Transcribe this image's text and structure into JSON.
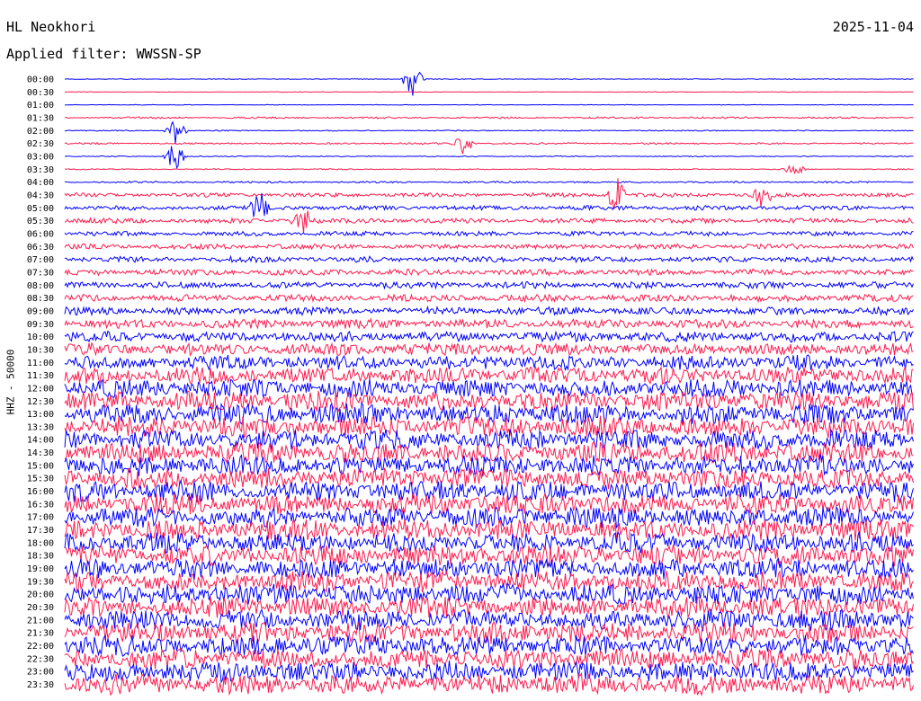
{
  "header": {
    "station": "HL Neokhori",
    "date": "2025-11-04",
    "filter_text": "Applied filter: WWSSN-SP"
  },
  "chart_data": {
    "type": "line",
    "channel_label": "HHZ - 50000",
    "colors": [
      "#0000ff",
      "#ff1a4d"
    ],
    "time_labels": [
      "00:00",
      "00:30",
      "01:00",
      "01:30",
      "02:00",
      "02:30",
      "03:00",
      "03:30",
      "04:00",
      "04:30",
      "05:00",
      "05:30",
      "06:00",
      "06:30",
      "07:00",
      "07:30",
      "08:00",
      "08:30",
      "09:00",
      "09:30",
      "10:00",
      "10:30",
      "11:00",
      "11:30",
      "12:00",
      "12:30",
      "13:00",
      "13:30",
      "14:00",
      "14:30",
      "15:00",
      "15:30",
      "16:00",
      "16:30",
      "17:00",
      "17:30",
      "18:00",
      "18:30",
      "19:00",
      "19:30",
      "20:00",
      "20:30",
      "21:00",
      "21:30",
      "22:00",
      "22:30",
      "23:00",
      "23:30"
    ],
    "relative_amplitude": [
      0.15,
      0.12,
      0.12,
      0.35,
      0.2,
      0.35,
      0.2,
      0.2,
      0.35,
      0.8,
      0.9,
      1.0,
      0.9,
      1.0,
      1.1,
      1.2,
      1.3,
      1.4,
      1.5,
      1.8,
      2.0,
      2.4,
      2.8,
      3.2,
      3.6,
      3.8,
      4.0,
      4.0,
      4.0,
      4.0,
      4.0,
      4.0,
      4.0,
      4.0,
      4.0,
      4.0,
      4.0,
      4.0,
      4.0,
      4.0,
      4.0,
      4.0,
      4.0,
      4.0,
      4.0,
      4.0,
      4.0,
      4.0
    ],
    "events": [
      {
        "trace": 0,
        "position": 0.41,
        "amplitude": 7
      },
      {
        "trace": 4,
        "position": 0.13,
        "amplitude": 6
      },
      {
        "trace": 5,
        "position": 0.47,
        "amplitude": 4
      },
      {
        "trace": 6,
        "position": 0.13,
        "amplitude": 5
      },
      {
        "trace": 7,
        "position": 0.86,
        "amplitude": 4
      },
      {
        "trace": 9,
        "position": 0.65,
        "amplitude": 6
      },
      {
        "trace": 9,
        "position": 0.82,
        "amplitude": 5
      },
      {
        "trace": 10,
        "position": 0.23,
        "amplitude": 5
      },
      {
        "trace": 11,
        "position": 0.28,
        "amplitude": 5
      }
    ]
  }
}
